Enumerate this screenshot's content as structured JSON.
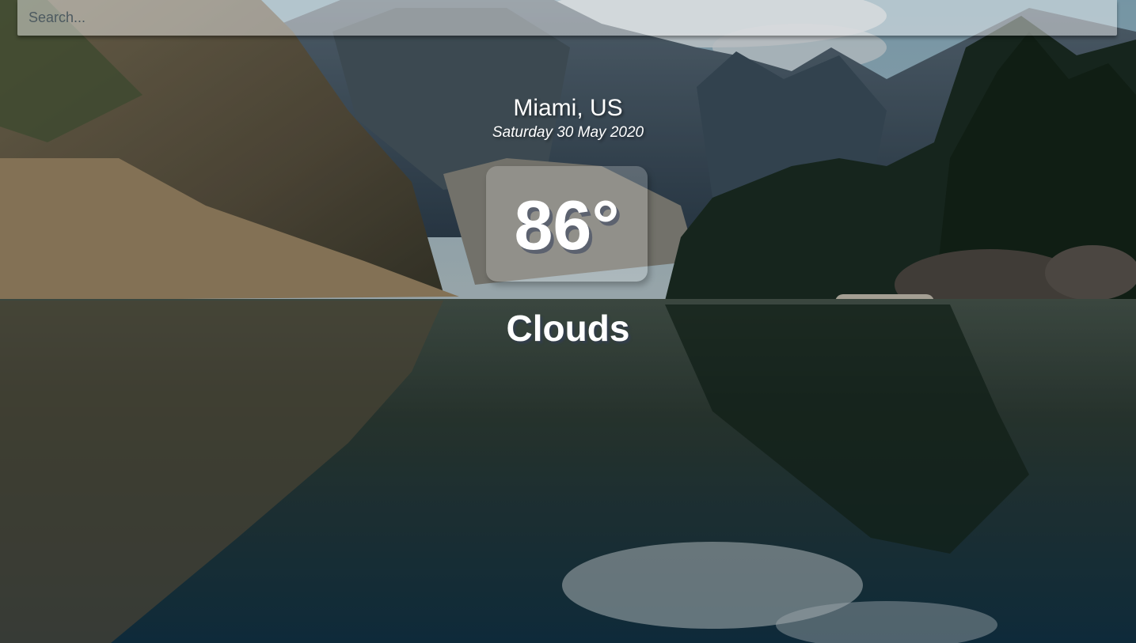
{
  "search": {
    "placeholder": "Search...",
    "value": ""
  },
  "location": {
    "city_country": "Miami, US",
    "date": "Saturday 30 May 2020"
  },
  "weather": {
    "temperature": "86°",
    "condition": "Clouds"
  },
  "background": {
    "scene": "mountain-lake-landscape-image"
  }
}
